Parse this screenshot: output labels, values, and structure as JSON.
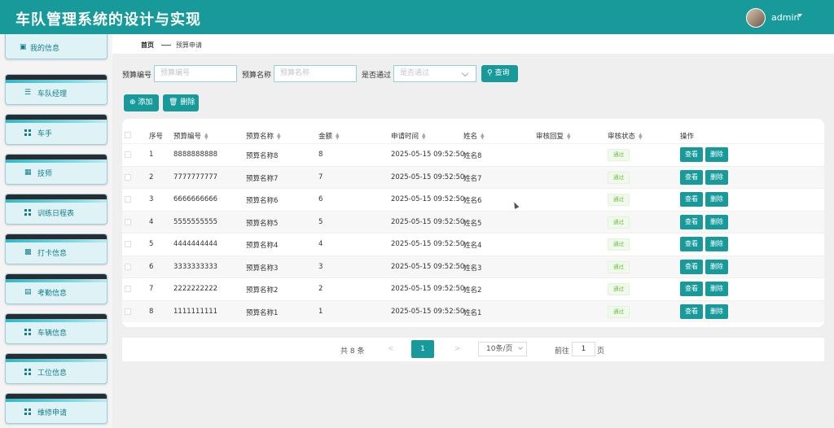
{
  "app": {
    "title": "车队管理系统的设计与实现",
    "user": "admin"
  },
  "sidebar": {
    "items": [
      {
        "label": "我的信息",
        "icon": "card-icon"
      },
      {
        "label": "车队经理",
        "icon": "list-icon"
      },
      {
        "label": "车手",
        "icon": "grid-icon"
      },
      {
        "label": "技师",
        "icon": "chart-icon"
      },
      {
        "label": "训练日程表",
        "icon": "grid-icon"
      },
      {
        "label": "打卡信息",
        "icon": "clipboard-icon"
      },
      {
        "label": "考勤信息",
        "icon": "briefcase-icon"
      },
      {
        "label": "车辆信息",
        "icon": "grid-icon"
      },
      {
        "label": "工位信息",
        "icon": "grid-icon"
      },
      {
        "label": "维修申请",
        "icon": "grid-icon"
      }
    ]
  },
  "breadcrumb": {
    "home": "首页",
    "current": "预算申请"
  },
  "filters": {
    "code_label": "预算编号",
    "code_placeholder": "预算编号",
    "name_label": "预算名称",
    "name_placeholder": "预算名称",
    "approved_label": "是否通过",
    "approved_placeholder": "是否通过",
    "search": "查询"
  },
  "toolbar": {
    "add": "添加",
    "delete": "删除"
  },
  "table": {
    "headers": {
      "index": "序号",
      "code": "预算编号",
      "name": "预算名称",
      "amount": "金额",
      "time": "申请时间",
      "applicant": "姓名",
      "reply": "审核回复",
      "status": "审核状态",
      "ops": "操作"
    },
    "rows": [
      {
        "index": "1",
        "code": "8888888888",
        "name": "预算名称8",
        "amount": "8",
        "time": "2025-05-15 09:52:50",
        "applicant": "姓名8",
        "reply": "",
        "status": "通过"
      },
      {
        "index": "2",
        "code": "7777777777",
        "name": "预算名称7",
        "amount": "7",
        "time": "2025-05-15 09:52:50",
        "applicant": "姓名7",
        "reply": "",
        "status": "通过"
      },
      {
        "index": "3",
        "code": "6666666666",
        "name": "预算名称6",
        "amount": "6",
        "time": "2025-05-15 09:52:50",
        "applicant": "姓名6",
        "reply": "",
        "status": "通过"
      },
      {
        "index": "4",
        "code": "5555555555",
        "name": "预算名称5",
        "amount": "5",
        "time": "2025-05-15 09:52:50",
        "applicant": "姓名5",
        "reply": "",
        "status": "通过"
      },
      {
        "index": "5",
        "code": "4444444444",
        "name": "预算名称4",
        "amount": "4",
        "time": "2025-05-15 09:52:50",
        "applicant": "姓名4",
        "reply": "",
        "status": "通过"
      },
      {
        "index": "6",
        "code": "3333333333",
        "name": "预算名称3",
        "amount": "3",
        "time": "2025-05-15 09:52:50",
        "applicant": "姓名3",
        "reply": "",
        "status": "通过"
      },
      {
        "index": "7",
        "code": "2222222222",
        "name": "预算名称2",
        "amount": "2",
        "time": "2025-05-15 09:52:50",
        "applicant": "姓名2",
        "reply": "",
        "status": "通过"
      },
      {
        "index": "8",
        "code": "1111111111",
        "name": "预算名称1",
        "amount": "1",
        "time": "2025-05-15 09:52:50",
        "applicant": "姓名1",
        "reply": "",
        "status": "通过"
      }
    ],
    "view_label": "查看",
    "delete_label": "删除"
  },
  "pagination": {
    "total": "共 8 条",
    "prev": "<",
    "current": "1",
    "next": ">",
    "page_size": "10条/页",
    "goto": "前往",
    "goto_value": "1",
    "page_unit": "页"
  },
  "colors": {
    "accent": "#189a9b",
    "status_success": "#67c23a"
  }
}
